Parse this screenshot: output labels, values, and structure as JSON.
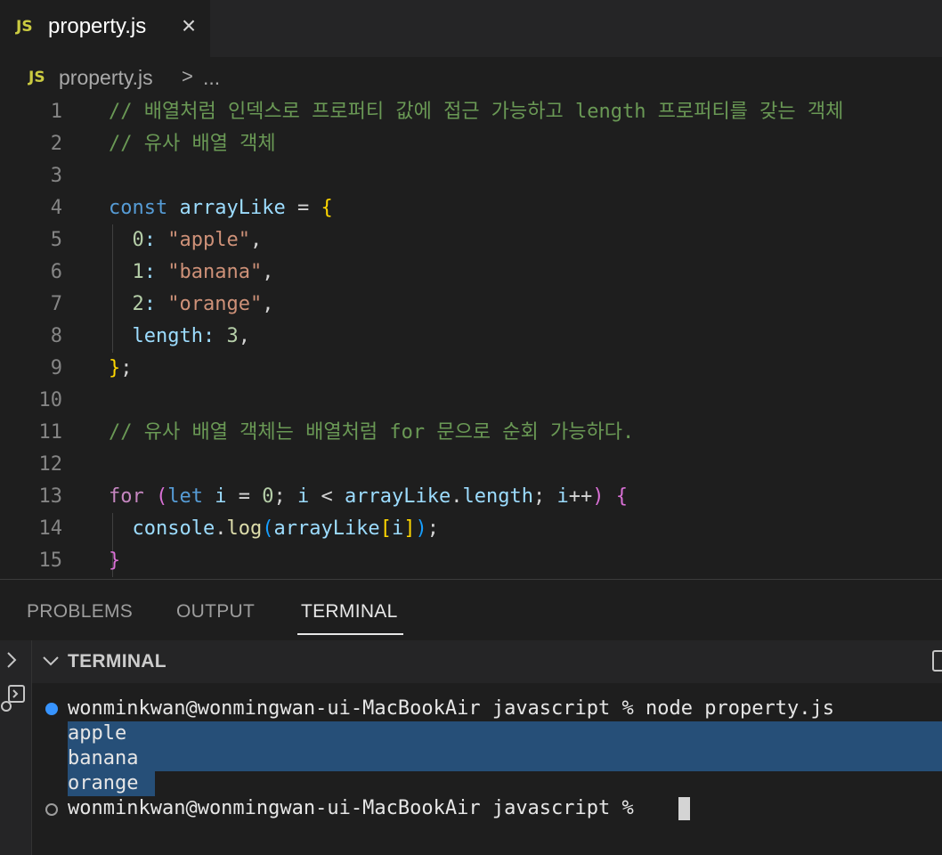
{
  "tab": {
    "badge": "JS",
    "title": "property.js",
    "close_icon": "×"
  },
  "breadcrumb": {
    "badge": "JS",
    "file": "property.js",
    "separator": ">",
    "ellipsis": "..."
  },
  "editor": {
    "line_numbers": [
      "1",
      "2",
      "3",
      "4",
      "5",
      "6",
      "7",
      "8",
      "9",
      "10",
      "11",
      "12",
      "13",
      "14",
      "15"
    ],
    "lines": {
      "l1_comment": "// 배열처럼 인덱스로 프로퍼티 값에 접근 가능하고 length 프로퍼티를 갖는 객체",
      "l2_comment": "// 유사 배열 객체",
      "l4_const": "const",
      "l4_name": "arrayLike",
      "l4_eq": " = ",
      "l4_brace": "{",
      "l5_key": "0",
      "l5_val": "\"apple\"",
      "l6_key": "1",
      "l6_val": "\"banana\"",
      "l7_key": "2",
      "l7_val": "\"orange\"",
      "l8_key": "length",
      "l8_val": "3",
      "l9_close": "}",
      "l11_comment": "// 유사 배열 객체는 배열처럼 for 문으로 순회 가능하다.",
      "l13_for": "for",
      "l13_let": "let",
      "l13_i": "i",
      "l13_zero": "0",
      "l13_i2": "i",
      "l13_arr": "arrayLike",
      "l13_len": "length",
      "l13_i3": "i",
      "l14_console": "console",
      "l14_log": "log",
      "l14_arr": "arrayLike",
      "l14_i": "i",
      "l15_close": "}"
    }
  },
  "panel": {
    "tabs": [
      {
        "label": "PROBLEMS"
      },
      {
        "label": "OUTPUT"
      },
      {
        "label": "TERMINAL"
      }
    ],
    "active_tab": "TERMINAL"
  },
  "terminal": {
    "header": "TERMINAL",
    "prompt1": "wonminkwan@wonmingwan-ui-MacBookAir javascript % node property.js",
    "output": [
      "apple",
      "banana",
      "orange"
    ],
    "prompt2": "wonminkwan@wonmingwan-ui-MacBookAir javascript % "
  },
  "colors": {
    "accent": "#3794ff",
    "selection": "#264f78",
    "js_badge": "#cbcb41"
  }
}
